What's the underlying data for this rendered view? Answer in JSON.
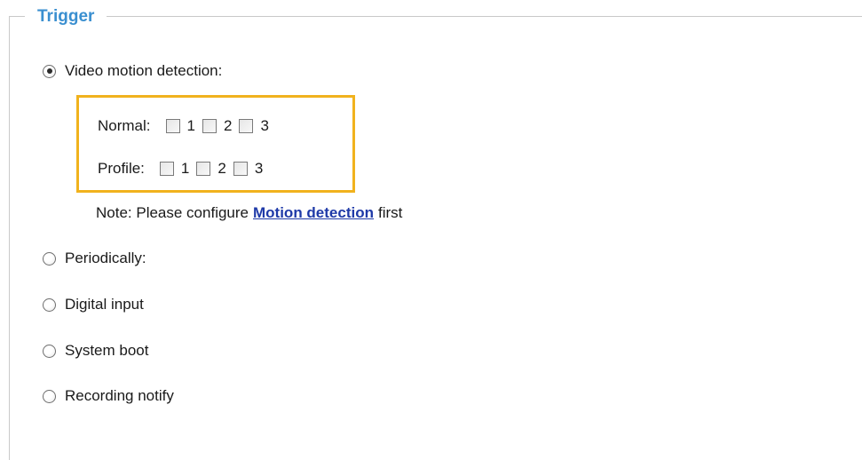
{
  "section": {
    "legend": "Trigger"
  },
  "trigger": {
    "video_motion": {
      "label": "Video motion detection:",
      "selected": true
    },
    "normal": {
      "label": "Normal:",
      "options": [
        "1",
        "2",
        "3"
      ]
    },
    "profile": {
      "label": "Profile:",
      "options": [
        "1",
        "2",
        "3"
      ]
    },
    "note": {
      "prefix": "Note: Please configure",
      "link": "Motion detection",
      "suffix": "first"
    },
    "periodically": {
      "label": "Periodically:"
    },
    "digital_input": {
      "label": "Digital input"
    },
    "system_boot": {
      "label": "System boot"
    },
    "recording_notify": {
      "label": "Recording notify"
    }
  },
  "colors": {
    "legend": "#3a8fd0",
    "highlight": "#f1b21d",
    "link": "#1f3aa8"
  }
}
